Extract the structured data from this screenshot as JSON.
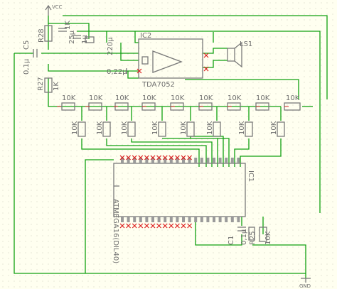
{
  "labels": {
    "vcc": "VCC",
    "gnd": "GND",
    "ic2": "IC2",
    "ic2_part": "TDA7052",
    "ls1": "LS1",
    "c5": "C5",
    "c5_val": "0,1μ",
    "c_amp": "0,22μ",
    "r28": "R28",
    "r28_val": "1K",
    "c_vcc": "1μ",
    "c_25": "25μ",
    "c_220": "220μ",
    "r27": "R27",
    "r27_val": "1K",
    "r_top": [
      "10K",
      "10K",
      "10K",
      "10K",
      "10K",
      "10K",
      "10K",
      "10K"
    ],
    "r_end": "10K",
    "r_low": [
      "10K",
      "10K",
      "10K",
      "10K",
      "10K",
      "10K",
      "10K",
      "10K"
    ],
    "ic1": "IC1",
    "ic1_part": "ATMEGA16(DIL40)",
    "c1": "C1",
    "r25": "R25",
    "c_bot": "0,1μ",
    "r_bot": "10K"
  }
}
